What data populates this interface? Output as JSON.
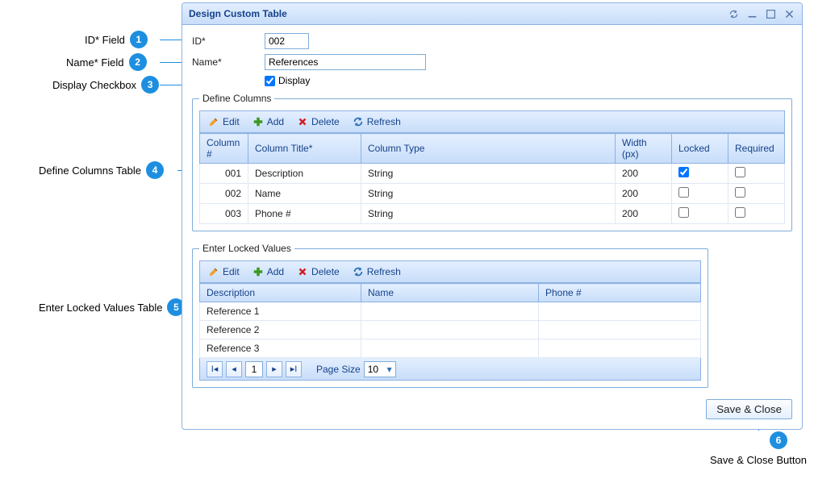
{
  "window": {
    "title": "Design Custom Table"
  },
  "form": {
    "id_label": "ID*",
    "id_value": "002",
    "name_label": "Name*",
    "name_value": "References",
    "display_label": "Display",
    "display_checked": true
  },
  "defineColumns": {
    "legend": "Define Columns",
    "toolbar": {
      "edit": "Edit",
      "add": "Add",
      "delete": "Delete",
      "refresh": "Refresh"
    },
    "headers": {
      "col": "Column #",
      "title": "Column Title*",
      "type": "Column Type",
      "width": "Width (px)",
      "locked": "Locked",
      "required": "Required"
    },
    "rows": [
      {
        "col": "001",
        "title": "Description",
        "type": "String",
        "width": "200",
        "locked": true,
        "required": false
      },
      {
        "col": "002",
        "title": "Name",
        "type": "String",
        "width": "200",
        "locked": false,
        "required": false
      },
      {
        "col": "003",
        "title": "Phone #",
        "type": "String",
        "width": "200",
        "locked": false,
        "required": false
      }
    ]
  },
  "lockedValues": {
    "legend": "Enter Locked Values",
    "toolbar": {
      "edit": "Edit",
      "add": "Add",
      "delete": "Delete",
      "refresh": "Refresh"
    },
    "headers": {
      "description": "Description",
      "name": "Name",
      "phone": "Phone #"
    },
    "rows": [
      {
        "description": "Reference 1",
        "name": "",
        "phone": ""
      },
      {
        "description": "Reference 2",
        "name": "",
        "phone": ""
      },
      {
        "description": "Reference 3",
        "name": "",
        "phone": ""
      }
    ],
    "pager": {
      "page": "1",
      "pageSizeLabel": "Page Size",
      "pageSize": "10"
    }
  },
  "footer": {
    "saveClose": "Save & Close"
  },
  "callouts": {
    "1": "ID* Field",
    "2": "Name* Field",
    "3": "Display Checkbox",
    "4": "Define Columns Table",
    "5": "Enter Locked Values Table",
    "6": "Save & Close Button"
  }
}
